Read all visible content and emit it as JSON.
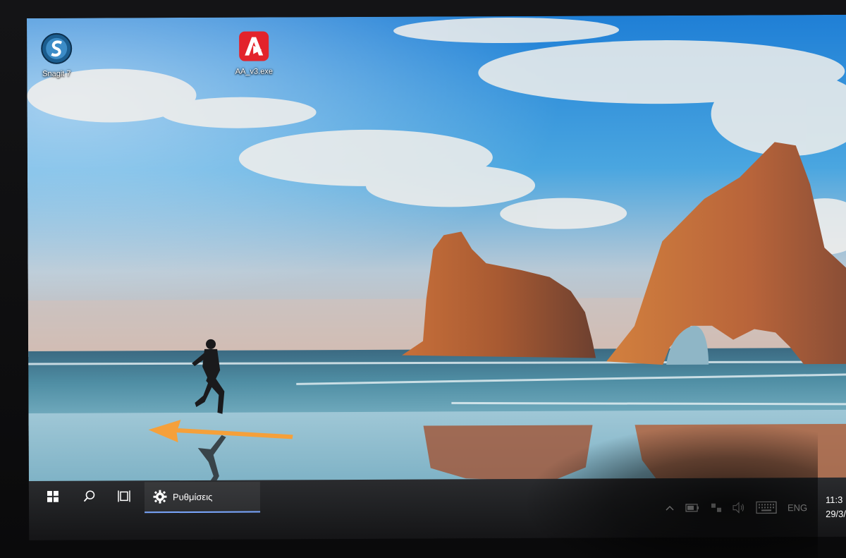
{
  "desktop": {
    "icons": [
      {
        "label": "Snagit 7",
        "icon": "snagit-icon"
      },
      {
        "label": "AA_v3.exe",
        "icon": "anydesk-icon"
      }
    ]
  },
  "taskbar": {
    "start_icon": "windows-logo-icon",
    "search_icon": "search-icon",
    "task_view_icon": "task-view-icon",
    "active_app": {
      "label": "Ρυθμίσεις",
      "icon": "gear-icon"
    },
    "tray": {
      "chevron_icon": "chevron-up-icon",
      "battery_icon": "battery-icon",
      "network_icon": "network-icon",
      "volume_icon": "volume-icon",
      "keyboard_icon": "touch-keyboard-icon",
      "language": "ENG",
      "time": "11:3",
      "date": "29/3/"
    }
  },
  "annotation": {
    "arrow_color": "#f5a03a"
  },
  "colors": {
    "taskbar": "#1f2022",
    "accent": "#7aa7ff"
  }
}
